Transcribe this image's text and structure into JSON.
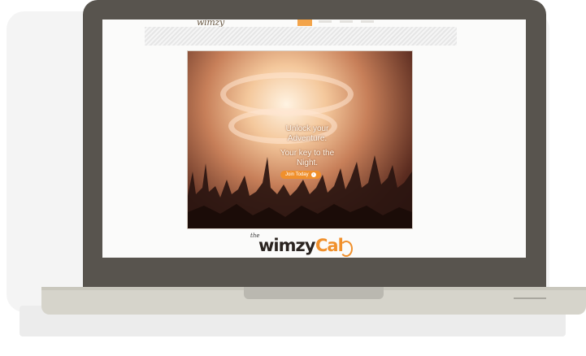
{
  "hero": {
    "line1": "Unlock your Adventure.",
    "line2": "Your key to the Night.",
    "join_label": "Join Today"
  },
  "header": {
    "logo_fragment": "wimzy"
  },
  "logo": {
    "the": "the",
    "wimzy": "wimzy",
    "cal": "Cal"
  },
  "colors": {
    "bezel": "#58544e",
    "accent": "#f0902c",
    "screen_bg": "#fbfbfa",
    "base": "#d6d4cb"
  },
  "icons": {
    "join_arrow": "arrow-right-icon"
  }
}
